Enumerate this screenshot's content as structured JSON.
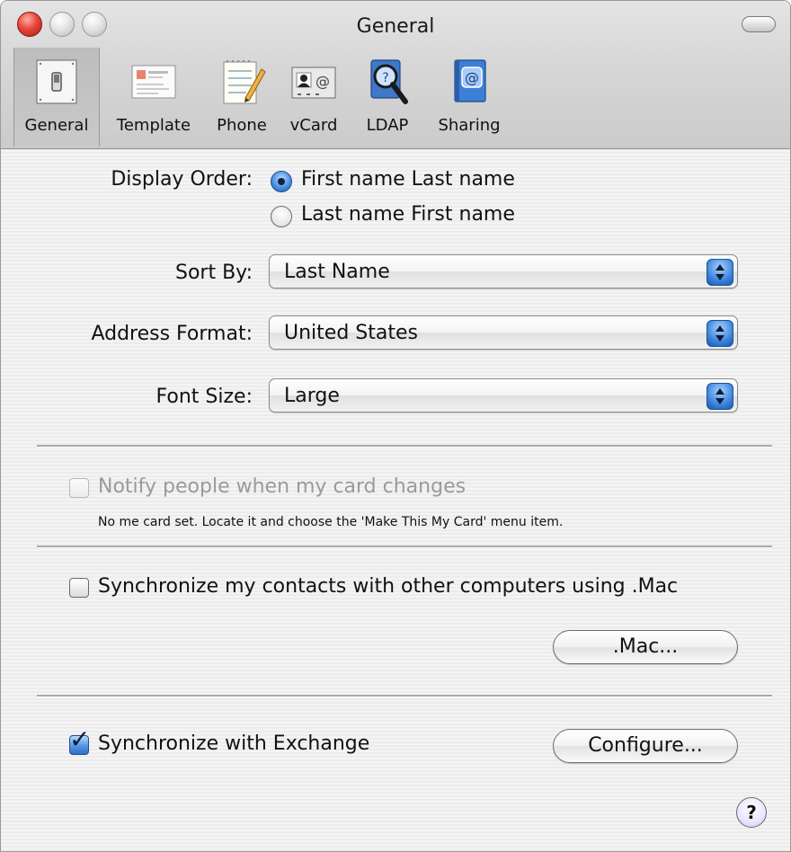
{
  "window": {
    "title": "General"
  },
  "toolbar": {
    "items": [
      {
        "label": "General",
        "icon": "switch-icon",
        "selected": true
      },
      {
        "label": "Template",
        "icon": "card-template-icon",
        "selected": false
      },
      {
        "label": "Phone",
        "icon": "notepad-pencil-icon",
        "selected": false
      },
      {
        "label": "vCard",
        "icon": "vcard-icon",
        "selected": false
      },
      {
        "label": "LDAP",
        "icon": "ldap-magnifier-icon",
        "selected": false
      },
      {
        "label": "Sharing",
        "icon": "sharing-book-icon",
        "selected": false
      }
    ]
  },
  "display_order": {
    "label": "Display Order:",
    "options": [
      {
        "label": "First name Last name",
        "selected": true
      },
      {
        "label": "Last name First name",
        "selected": false
      }
    ]
  },
  "sort_by": {
    "label": "Sort By:",
    "value": "Last Name"
  },
  "address_format": {
    "label": "Address Format:",
    "value": "United States"
  },
  "font_size": {
    "label": "Font Size:",
    "value": "Large"
  },
  "notify": {
    "label": "Notify people when my card changes",
    "checked": false,
    "enabled": false,
    "note": "No me card set. Locate it and choose the 'Make This My Card' menu item."
  },
  "sync_mac": {
    "label": "Synchronize my contacts with other computers using .Mac",
    "checked": false,
    "button_label": ".Mac..."
  },
  "sync_exchange": {
    "label": "Synchronize with Exchange",
    "checked": true,
    "button_label": "Configure..."
  },
  "help": {
    "label": "?"
  },
  "colors": {
    "accent": "#3d85df",
    "divider": "#a9a9a9",
    "close_button": "#e8453a"
  }
}
